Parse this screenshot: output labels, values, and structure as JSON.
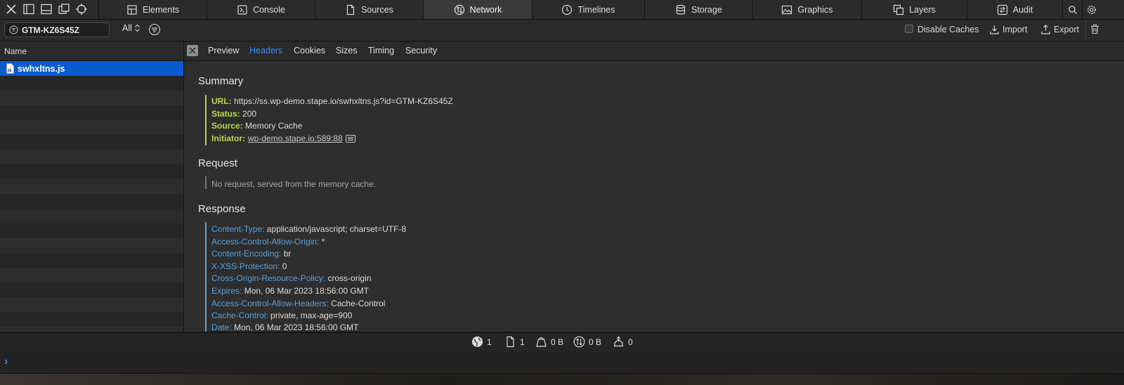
{
  "tabs": [
    {
      "label": "Elements",
      "icon": "elements-icon"
    },
    {
      "label": "Console",
      "icon": "console-icon"
    },
    {
      "label": "Sources",
      "icon": "document-icon"
    },
    {
      "label": "Network",
      "icon": "network-icon",
      "active": true
    },
    {
      "label": "Timelines",
      "icon": "clock-icon"
    },
    {
      "label": "Storage",
      "icon": "database-icon"
    },
    {
      "label": "Graphics",
      "icon": "image-icon"
    },
    {
      "label": "Layers",
      "icon": "layers-icon"
    },
    {
      "label": "Audit",
      "icon": "audit-icon"
    }
  ],
  "toolbar": {
    "filter_value": "GTM-KZ6S45Z",
    "type_filter": "All",
    "disable_caches": "Disable Caches",
    "disable_caches_checked": false,
    "import": "Import",
    "export": "Export"
  },
  "left": {
    "header": "Name",
    "rows": [
      {
        "name": "swhxltns.js",
        "selected": true
      }
    ]
  },
  "detail": {
    "tabs": [
      "Preview",
      "Headers",
      "Cookies",
      "Sizes",
      "Timing",
      "Security"
    ],
    "active_tab": "Headers",
    "summary": {
      "title": "Summary",
      "items": [
        {
          "key": "URL:",
          "value": "https://ss.wp-demo.stape.io/swhxltns.js?id=GTM-KZ6S45Z"
        },
        {
          "key": "Status:",
          "value": "200"
        },
        {
          "key": "Source:",
          "value": "Memory Cache"
        },
        {
          "key": "Initiator:",
          "value": "wp-demo.stape.io:589:88"
        }
      ]
    },
    "request": {
      "title": "Request",
      "note": "No request, served from the memory cache."
    },
    "response": {
      "title": "Response",
      "items": [
        {
          "key": "Content-Type:",
          "value": "application/javascript; charset=UTF-8"
        },
        {
          "key": "Access-Control-Allow-Origin:",
          "value": "*"
        },
        {
          "key": "Content-Encoding:",
          "value": "br"
        },
        {
          "key": "X-XSS-Protection:",
          "value": "0"
        },
        {
          "key": "Cross-Origin-Resource-Policy:",
          "value": "cross-origin"
        },
        {
          "key": "Expires:",
          "value": "Mon, 06 Mar 2023 18:56:00 GMT"
        },
        {
          "key": "Access-Control-Allow-Headers:",
          "value": "Cache-Control"
        },
        {
          "key": "Cache-Control:",
          "value": "private, max-age=900"
        },
        {
          "key": "Date:",
          "value": "Mon, 06 Mar 2023 18:56:00 GMT"
        }
      ]
    }
  },
  "status": {
    "resources": "1",
    "documents": "1",
    "transferred": "0 B",
    "size": "0 B",
    "time": "0"
  },
  "console": {
    "prompt": "›"
  },
  "colors": {
    "accent": "#3b8df0",
    "selection": "#0b5bd0",
    "summary_key": "#b9d94a",
    "response_key": "#5d9fd6"
  }
}
